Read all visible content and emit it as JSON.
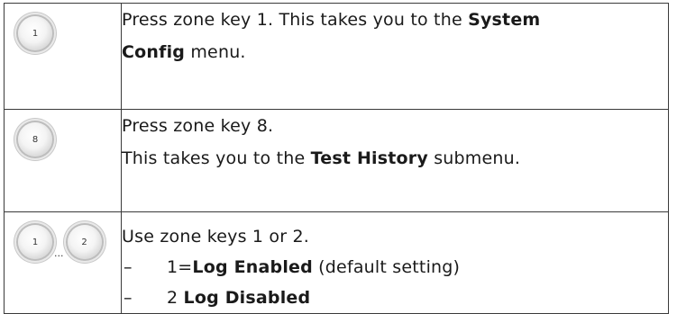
{
  "rows": [
    {
      "keys": [
        "1"
      ],
      "line1_pre": "Press zone key 1. This takes you to the ",
      "line1_bold": "System",
      "line2_bold": "Config",
      "line2_post": " menu."
    },
    {
      "keys": [
        "8"
      ],
      "line1": "Press zone key 8.",
      "line2_pre": "This takes you to the ",
      "line2_bold": "Test History",
      "line2_post": " submenu."
    },
    {
      "keys": [
        "1",
        "2"
      ],
      "ellipsis": "...",
      "line1": "Use zone keys 1 or 2.",
      "options": [
        {
          "dash": "–",
          "pre": "1=",
          "bold": "Log Enabled",
          "post": " (default setting)"
        },
        {
          "dash": "–",
          "pre": "2 ",
          "bold": "Log Disabled",
          "post": ""
        }
      ]
    }
  ]
}
